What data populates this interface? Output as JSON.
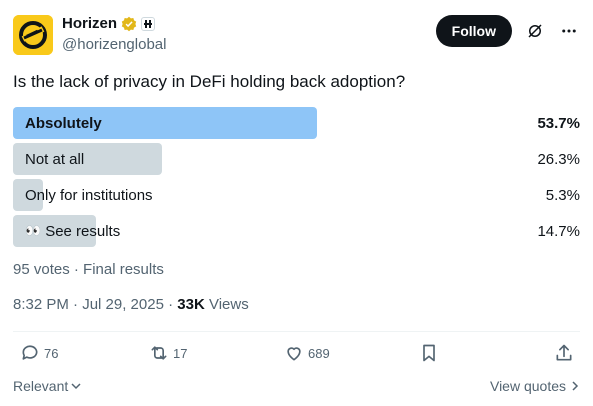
{
  "header": {
    "display_name": "Horizen",
    "handle": "@horizenglobal",
    "follow_label": "Follow",
    "avatar_color": "#f9c91a"
  },
  "tweet": {
    "question": "Is the lack of privacy in DeFi holding back adoption?"
  },
  "poll": {
    "options": [
      {
        "label": "Absolutely",
        "percent_text": "53.7%",
        "fraction": 0.537,
        "winner": true
      },
      {
        "label": "Not at all",
        "percent_text": "26.3%",
        "fraction": 0.263,
        "winner": false
      },
      {
        "label": "Only for institutions",
        "percent_text": "5.3%",
        "fraction": 0.053,
        "winner": false
      },
      {
        "label": "See results",
        "percent_text": "14.7%",
        "fraction": 0.147,
        "winner": false,
        "emoji": "👀"
      }
    ],
    "meta": "95 votes · Final results"
  },
  "timestamp": {
    "time_date": "8:32 PM · Jul 29, 2025 · ",
    "views_count": "33K",
    "views_label": " Views"
  },
  "actions": {
    "replies": "76",
    "reposts": "17",
    "likes": "689"
  },
  "footer": {
    "sort_label": "Relevant",
    "view_quotes_label": "View quotes"
  },
  "colors": {
    "winner_bar": "#8ec5f7",
    "bar": "#cfd9de",
    "muted_text": "#536471",
    "verified": "#e2b719"
  },
  "icons": [
    "verified-badge-icon",
    "affiliate-icon",
    "grok-icon",
    "more-icon",
    "reply-icon",
    "repost-icon",
    "like-icon",
    "bookmark-icon",
    "share-icon",
    "chevron-down-icon",
    "chevron-right-icon"
  ]
}
